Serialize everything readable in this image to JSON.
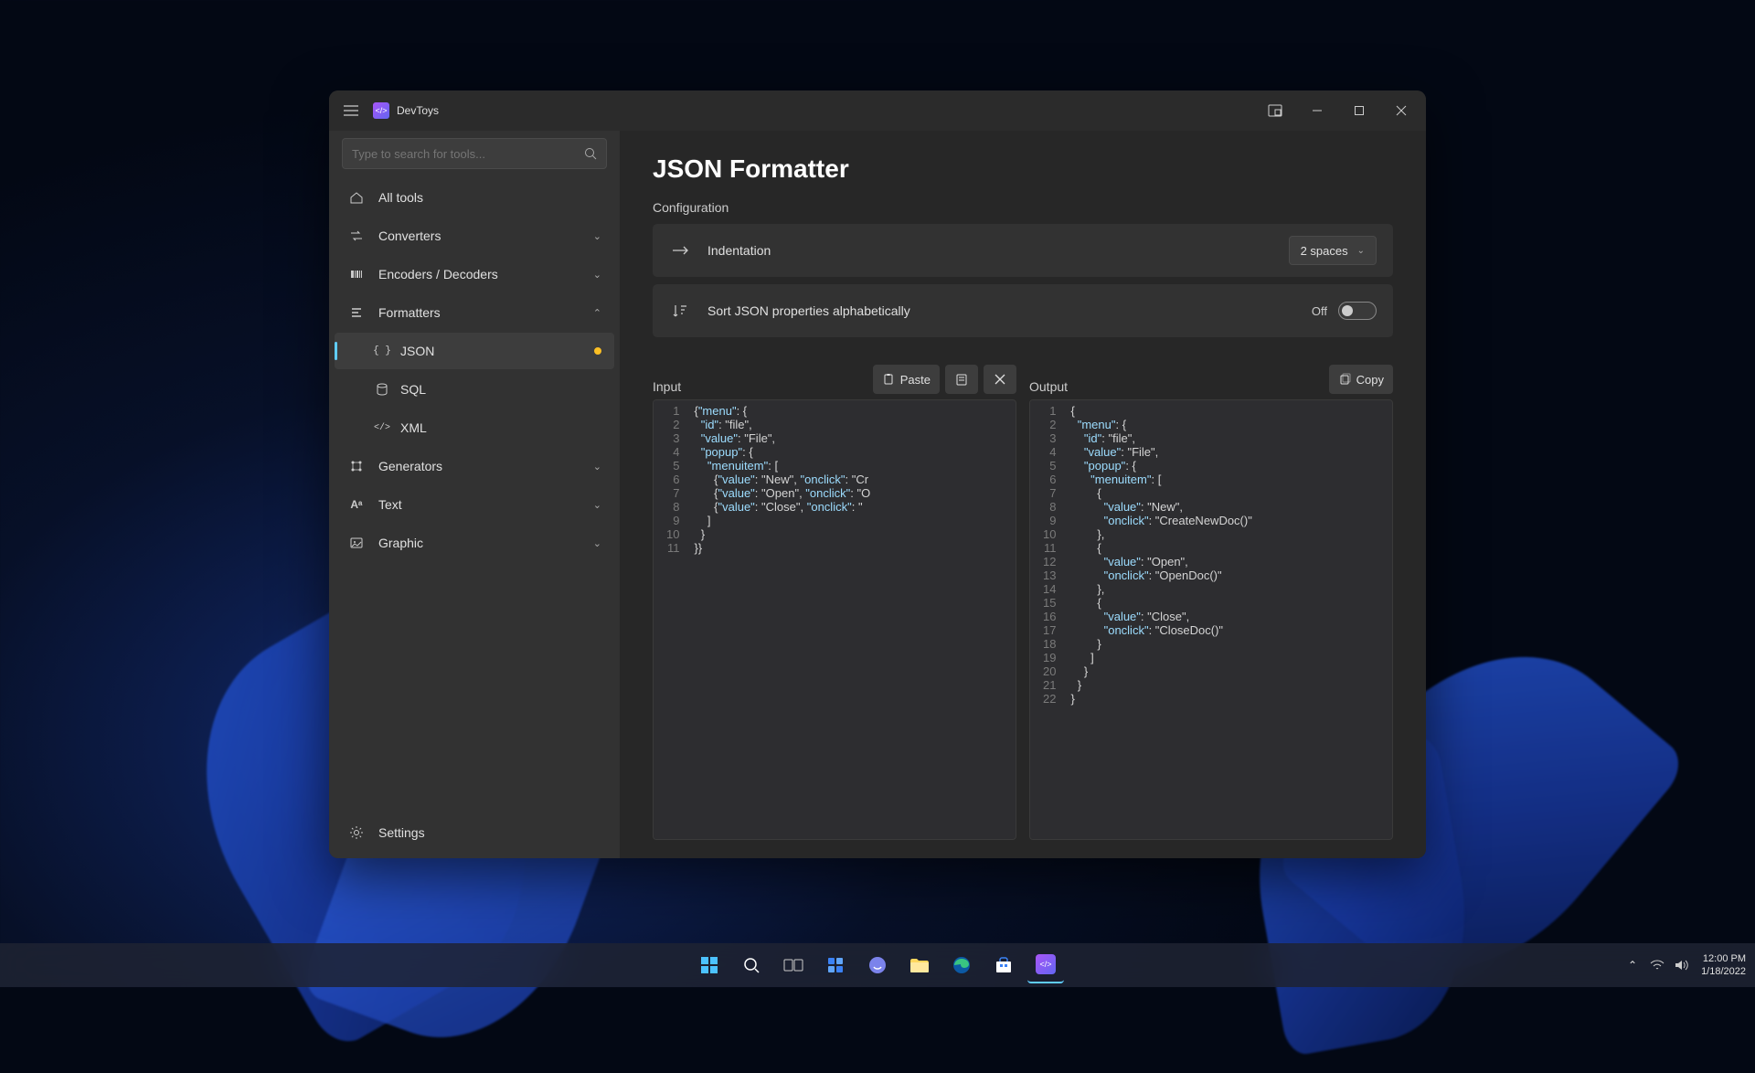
{
  "app": {
    "title": "DevToys"
  },
  "window_controls": {
    "compact": "compact-overlay",
    "minimize": "minimize",
    "maximize": "maximize",
    "close": "close"
  },
  "search": {
    "placeholder": "Type to search for tools..."
  },
  "sidebar": {
    "all_tools": "All tools",
    "groups": {
      "converters": "Converters",
      "encoders": "Encoders / Decoders",
      "formatters": "Formatters",
      "generators": "Generators",
      "text": "Text",
      "graphic": "Graphic"
    },
    "formatters_children": {
      "json": "JSON",
      "sql": "SQL",
      "xml": "XML"
    },
    "settings": "Settings"
  },
  "page": {
    "title": "JSON Formatter",
    "configuration_label": "Configuration",
    "indentation": {
      "label": "Indentation",
      "value": "2 spaces"
    },
    "sort": {
      "label": "Sort JSON properties alphabetically",
      "state": "Off"
    }
  },
  "io": {
    "input_label": "Input",
    "output_label": "Output",
    "paste": "Paste",
    "copy": "Copy"
  },
  "input_code": [
    "{\"menu\": {",
    "  \"id\": \"file\",",
    "  \"value\": \"File\",",
    "  \"popup\": {",
    "    \"menuitem\": [",
    "      {\"value\": \"New\", \"onclick\": \"Cr",
    "      {\"value\": \"Open\", \"onclick\": \"O",
    "      {\"value\": \"Close\", \"onclick\": \"",
    "    ]",
    "  }",
    "}}"
  ],
  "output_code": [
    "{",
    "  \"menu\": {",
    "    \"id\": \"file\",",
    "    \"value\": \"File\",",
    "    \"popup\": {",
    "      \"menuitem\": [",
    "        {",
    "          \"value\": \"New\",",
    "          \"onclick\": \"CreateNewDoc()\"",
    "        },",
    "        {",
    "          \"value\": \"Open\",",
    "          \"onclick\": \"OpenDoc()\"",
    "        },",
    "        {",
    "          \"value\": \"Close\",",
    "          \"onclick\": \"CloseDoc()\"",
    "        }",
    "      ]",
    "    }",
    "  }",
    "}"
  ],
  "taskbar": {
    "time": "12:00 PM",
    "date": "1/18/2022"
  }
}
